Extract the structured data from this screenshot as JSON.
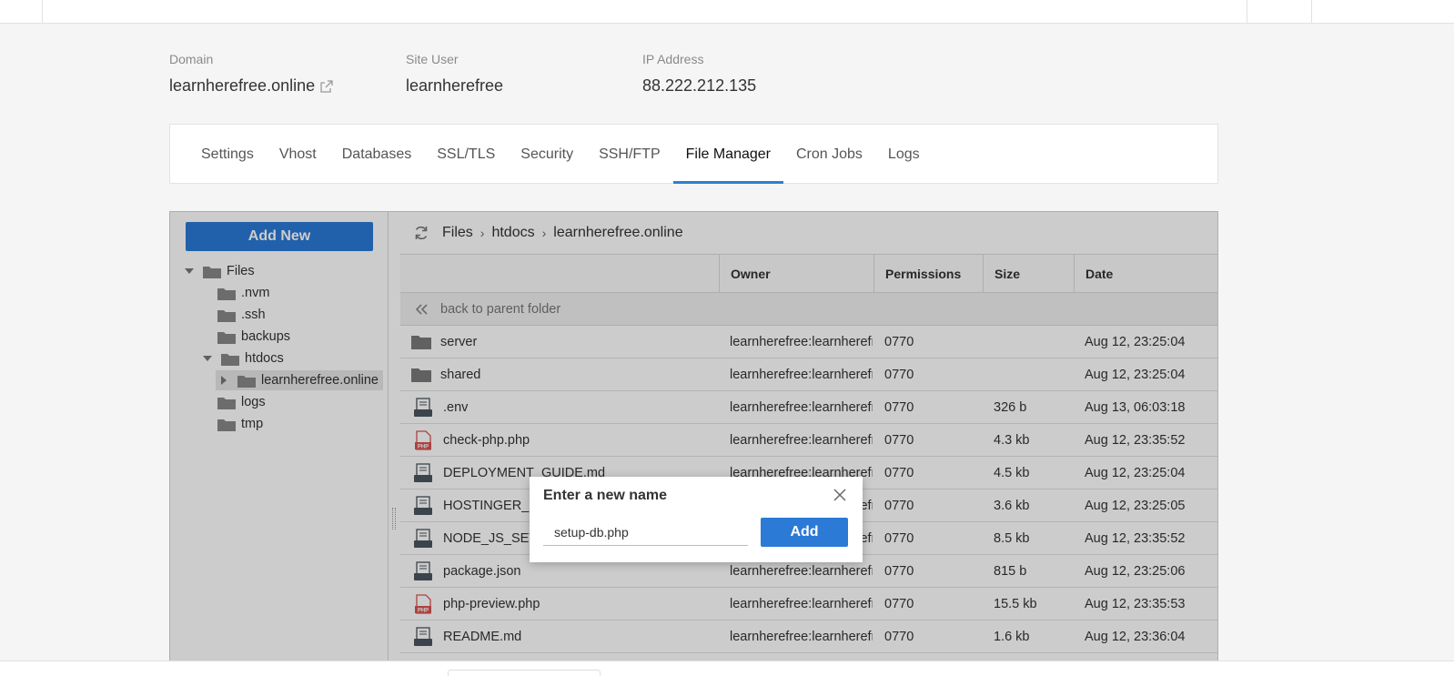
{
  "site_info": {
    "domain_label": "Domain",
    "domain_value": "learnherefree.online",
    "site_user_label": "Site User",
    "site_user_value": "learnherefree",
    "ip_label": "IP Address",
    "ip_value": "88.222.212.135"
  },
  "tabs": [
    {
      "label": "Settings"
    },
    {
      "label": "Vhost"
    },
    {
      "label": "Databases"
    },
    {
      "label": "SSL/TLS"
    },
    {
      "label": "Security"
    },
    {
      "label": "SSH/FTP"
    },
    {
      "label": "File Manager",
      "active": true
    },
    {
      "label": "Cron Jobs"
    },
    {
      "label": "Logs"
    }
  ],
  "file_manager": {
    "add_new_label": "Add New",
    "tree": [
      {
        "label": "Files",
        "expanded": true
      },
      {
        "label": ".nvm"
      },
      {
        "label": ".ssh"
      },
      {
        "label": "backups"
      },
      {
        "label": "htdocs",
        "expanded": true
      },
      {
        "label": "learnherefree.online",
        "selected": true
      },
      {
        "label": "logs"
      },
      {
        "label": "tmp"
      }
    ],
    "breadcrumb": [
      "Files",
      "htdocs",
      "learnherefree.online"
    ],
    "columns": {
      "owner": "Owner",
      "permissions": "Permissions",
      "size": "Size",
      "date": "Date"
    },
    "back_label": "back to parent folder",
    "rows": [
      {
        "name": "server",
        "type": "folder",
        "owner": "learnherefree:learnherefr",
        "permissions": "0770",
        "size": "",
        "date": "Aug 12, 23:25:04"
      },
      {
        "name": "shared",
        "type": "folder",
        "owner": "learnherefree:learnherefr",
        "permissions": "0770",
        "size": "",
        "date": "Aug 12, 23:25:04"
      },
      {
        "name": ".env",
        "type": "file",
        "owner": "learnherefree:learnherefr",
        "permissions": "0770",
        "size": "326 b",
        "date": "Aug 13, 06:03:18"
      },
      {
        "name": "check-php.php",
        "type": "php",
        "owner": "learnherefree:learnherefr",
        "permissions": "0770",
        "size": "4.3 kb",
        "date": "Aug 12, 23:35:52"
      },
      {
        "name": "DEPLOYMENT_GUIDE.md",
        "type": "file",
        "owner": "learnherefree:learnherefr",
        "permissions": "0770",
        "size": "4.5 kb",
        "date": "Aug 12, 23:25:04"
      },
      {
        "name": "HOSTINGER_U",
        "type": "file",
        "owner": "learnherefree:learnherefr",
        "permissions": "0770",
        "size": "3.6 kb",
        "date": "Aug 12, 23:25:05"
      },
      {
        "name": "NODE_JS_SETU",
        "type": "file",
        "owner": "learnherefree:learnherefr",
        "permissions": "0770",
        "size": "8.5 kb",
        "date": "Aug 12, 23:35:52"
      },
      {
        "name": "package.json",
        "type": "file",
        "owner": "learnherefree:learnherefr",
        "permissions": "0770",
        "size": "815 b",
        "date": "Aug 12, 23:25:06"
      },
      {
        "name": "php-preview.php",
        "type": "php",
        "owner": "learnherefree:learnherefr",
        "permissions": "0770",
        "size": "15.5 kb",
        "date": "Aug 12, 23:35:53"
      },
      {
        "name": "README.md",
        "type": "file",
        "owner": "learnherefree:learnherefr",
        "permissions": "0770",
        "size": "1.6 kb",
        "date": "Aug 12, 23:36:04"
      }
    ]
  },
  "dialog": {
    "title": "Enter a new name",
    "input_value": "setup-db.php",
    "add_label": "Add",
    "php_badge": "PHP"
  },
  "colors": {
    "accent": "#2a7ad6",
    "tab_underline": "#2a80d2",
    "php_red": "#d9534f",
    "icon_gray": "#4a5560"
  }
}
